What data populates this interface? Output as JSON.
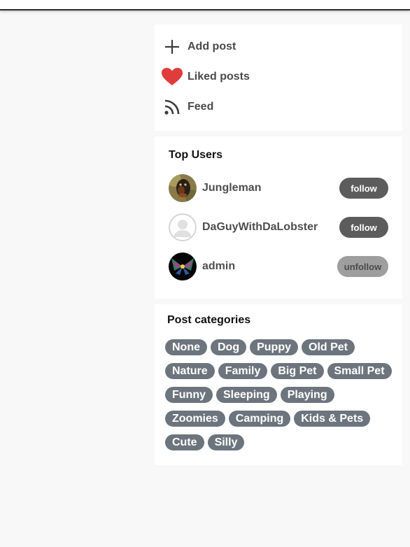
{
  "actions": {
    "add_post": "Add post",
    "liked_posts": "Liked posts",
    "feed": "Feed",
    "heart_color": "#e03c3c"
  },
  "top_users": {
    "title": "Top Users",
    "users": [
      {
        "name": "Jungleman",
        "button": "follow"
      },
      {
        "name": "DaGuyWithDaLobster",
        "button": "follow"
      },
      {
        "name": "admin",
        "button": "unfollow"
      }
    ]
  },
  "categories": {
    "title": "Post categories",
    "tags": [
      "None",
      "Dog",
      "Puppy",
      "Old Pet",
      "Nature",
      "Family",
      "Big Pet",
      "Small Pet",
      "Funny",
      "Sleeping",
      "Playing",
      "Zoomies",
      "Camping",
      "Kids & Pets",
      "Cute",
      "Silly"
    ]
  },
  "colors": {
    "tag_bg": "#6c757d",
    "follow_bg": "#5c5c5c",
    "unfollow_bg": "#9e9e9e"
  }
}
